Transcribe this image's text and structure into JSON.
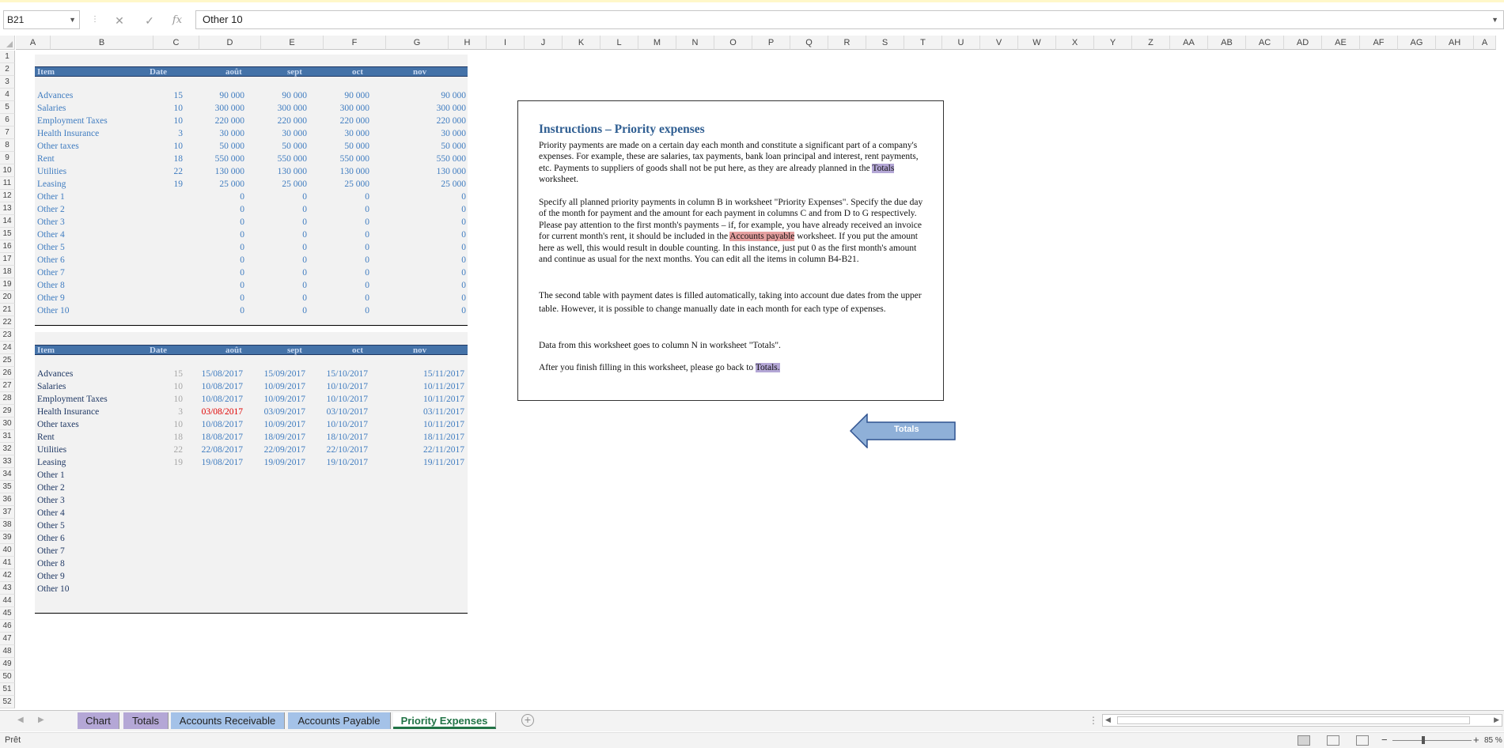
{
  "formula_bar": {
    "name_box": "B21",
    "content": "Other 10"
  },
  "columns": [
    "A",
    "B",
    "C",
    "D",
    "E",
    "F",
    "G",
    "H",
    "I",
    "J",
    "K",
    "L",
    "M",
    "N",
    "O",
    "P",
    "Q",
    "R",
    "S",
    "T",
    "U",
    "V",
    "W",
    "X",
    "Y",
    "Z",
    "AA",
    "AB",
    "AC",
    "AD",
    "AE",
    "AF",
    "AG",
    "AH",
    "A"
  ],
  "rows": [
    "1",
    "2",
    "3",
    "4",
    "5",
    "6",
    "7",
    "8",
    "9",
    "10",
    "11",
    "12",
    "13",
    "14",
    "15",
    "16",
    "17",
    "18",
    "19",
    "20",
    "21",
    "22",
    "23",
    "24",
    "25",
    "26",
    "27",
    "28",
    "29",
    "30",
    "31",
    "32",
    "33",
    "34",
    "35",
    "36",
    "37",
    "38",
    "39",
    "40",
    "41",
    "42",
    "43",
    "44",
    "45",
    "46",
    "47",
    "48",
    "49",
    "50",
    "51",
    "52"
  ],
  "table1": {
    "headers": [
      "Item",
      "Date",
      "août",
      "sept",
      "oct",
      "nov"
    ],
    "rows": [
      {
        "item": "Advances",
        "day": "15",
        "m1": "90 000",
        "m2": "90 000",
        "m3": "90 000",
        "m4": "90 000"
      },
      {
        "item": "Salaries",
        "day": "10",
        "m1": "300 000",
        "m2": "300 000",
        "m3": "300 000",
        "m4": "300 000"
      },
      {
        "item": "Employment Taxes",
        "day": "10",
        "m1": "220 000",
        "m2": "220 000",
        "m3": "220 000",
        "m4": "220 000"
      },
      {
        "item": "Health Insurance",
        "day": "3",
        "m1": "30 000",
        "m2": "30 000",
        "m3": "30 000",
        "m4": "30 000"
      },
      {
        "item": "Other taxes",
        "day": "10",
        "m1": "50 000",
        "m2": "50 000",
        "m3": "50 000",
        "m4": "50 000"
      },
      {
        "item": "Rent",
        "day": "18",
        "m1": "550 000",
        "m2": "550 000",
        "m3": "550 000",
        "m4": "550 000"
      },
      {
        "item": "Utilities",
        "day": "22",
        "m1": "130 000",
        "m2": "130 000",
        "m3": "130 000",
        "m4": "130 000"
      },
      {
        "item": "Leasing",
        "day": "19",
        "m1": "25 000",
        "m2": "25 000",
        "m3": "25 000",
        "m4": "25 000"
      },
      {
        "item": "Other 1",
        "day": "",
        "m1": "0",
        "m2": "0",
        "m3": "0",
        "m4": "0"
      },
      {
        "item": "Other 2",
        "day": "",
        "m1": "0",
        "m2": "0",
        "m3": "0",
        "m4": "0"
      },
      {
        "item": "Other 3",
        "day": "",
        "m1": "0",
        "m2": "0",
        "m3": "0",
        "m4": "0"
      },
      {
        "item": "Other 4",
        "day": "",
        "m1": "0",
        "m2": "0",
        "m3": "0",
        "m4": "0"
      },
      {
        "item": "Other 5",
        "day": "",
        "m1": "0",
        "m2": "0",
        "m3": "0",
        "m4": "0"
      },
      {
        "item": "Other 6",
        "day": "",
        "m1": "0",
        "m2": "0",
        "m3": "0",
        "m4": "0"
      },
      {
        "item": "Other 7",
        "day": "",
        "m1": "0",
        "m2": "0",
        "m3": "0",
        "m4": "0"
      },
      {
        "item": "Other 8",
        "day": "",
        "m1": "0",
        "m2": "0",
        "m3": "0",
        "m4": "0"
      },
      {
        "item": "Other 9",
        "day": "",
        "m1": "0",
        "m2": "0",
        "m3": "0",
        "m4": "0"
      },
      {
        "item": "Other 10",
        "day": "",
        "m1": "0",
        "m2": "0",
        "m3": "0",
        "m4": "0"
      }
    ]
  },
  "table2": {
    "headers": [
      "Item",
      "Date",
      "août",
      "sept",
      "oct",
      "nov"
    ],
    "rows": [
      {
        "item": "Advances",
        "day": "15",
        "m1": "15/08/2017",
        "m2": "15/09/2017",
        "m3": "15/10/2017",
        "m4": "15/11/2017"
      },
      {
        "item": "Salaries",
        "day": "10",
        "m1": "10/08/2017",
        "m2": "10/09/2017",
        "m3": "10/10/2017",
        "m4": "10/11/2017"
      },
      {
        "item": "Employment Taxes",
        "day": "10",
        "m1": "10/08/2017",
        "m2": "10/09/2017",
        "m3": "10/10/2017",
        "m4": "10/11/2017"
      },
      {
        "item": "Health Insurance",
        "day": "3",
        "m1": "03/08/2017",
        "m2": "03/09/2017",
        "m3": "03/10/2017",
        "m4": "03/11/2017",
        "alert": true
      },
      {
        "item": "Other taxes",
        "day": "10",
        "m1": "10/08/2017",
        "m2": "10/09/2017",
        "m3": "10/10/2017",
        "m4": "10/11/2017"
      },
      {
        "item": "Rent",
        "day": "18",
        "m1": "18/08/2017",
        "m2": "18/09/2017",
        "m3": "18/10/2017",
        "m4": "18/11/2017"
      },
      {
        "item": "Utilities",
        "day": "22",
        "m1": "22/08/2017",
        "m2": "22/09/2017",
        "m3": "22/10/2017",
        "m4": "22/11/2017"
      },
      {
        "item": "Leasing",
        "day": "19",
        "m1": "19/08/2017",
        "m2": "19/09/2017",
        "m3": "19/10/2017",
        "m4": "19/11/2017"
      },
      {
        "item": "Other 1",
        "day": "",
        "m1": "",
        "m2": "",
        "m3": "",
        "m4": ""
      },
      {
        "item": "Other 2",
        "day": "",
        "m1": "",
        "m2": "",
        "m3": "",
        "m4": ""
      },
      {
        "item": "Other 3",
        "day": "",
        "m1": "",
        "m2": "",
        "m3": "",
        "m4": ""
      },
      {
        "item": "Other 4",
        "day": "",
        "m1": "",
        "m2": "",
        "m3": "",
        "m4": ""
      },
      {
        "item": "Other 5",
        "day": "",
        "m1": "",
        "m2": "",
        "m3": "",
        "m4": ""
      },
      {
        "item": "Other 6",
        "day": "",
        "m1": "",
        "m2": "",
        "m3": "",
        "m4": ""
      },
      {
        "item": "Other 7",
        "day": "",
        "m1": "",
        "m2": "",
        "m3": "",
        "m4": ""
      },
      {
        "item": "Other 8",
        "day": "",
        "m1": "",
        "m2": "",
        "m3": "",
        "m4": ""
      },
      {
        "item": "Other 9",
        "day": "",
        "m1": "",
        "m2": "",
        "m3": "",
        "m4": ""
      },
      {
        "item": "Other 10",
        "day": "",
        "m1": "",
        "m2": "",
        "m3": "",
        "m4": ""
      }
    ]
  },
  "instructions": {
    "title": "Instructions – Priority expenses",
    "p1_a": "Priority payments are made on a certain day each month and constitute a significant part of a company's expenses. For example, these are salaries, tax payments, bank loan principal and interest, rent payments, etc. Payments to suppliers of goods shall not be put here, as they are already planned in the ",
    "p1_link": "Totals",
    "p1_b": " worksheet.",
    "p2_a": "Specify all planned priority payments in column B in worksheet \"Priority Expenses\". Specify the due day of the month for payment and the amount for each payment in columns C and from D to G respectively. Please pay attention to the first month's payments – if, for example, you have already received an invoice for current month's rent, it should be included in the ",
    "p2_link": "Accounts payable",
    "p2_b": " worksheet. If you put the amount here as well, this would result in double counting. In this instance, just put 0 as the first month's amount and continue as usual for the next months. You can edit all the items in column B4-B21.",
    "p3": "The second table with payment dates is filled automatically, taking into account due dates from the upper table. However, it is possible to change manually date in each month for each type of expenses.",
    "p4": "Data from this worksheet goes to column N in worksheet \"Totals\".",
    "p5_a": "After you finish filling in this worksheet, please go back to ",
    "p5_link": "Totals."
  },
  "arrow_button": {
    "label": "Totals"
  },
  "tabs": [
    "Chart",
    "Totals",
    "Accounts Receivable",
    "Accounts Payable",
    "Priority Expenses"
  ],
  "status": {
    "text": "Prêt",
    "zoom": "85 %"
  },
  "colors": {
    "header_blue": "#4472a8",
    "label_blue": "#3f7cc0",
    "label_dark": "#1f3864",
    "alert_red": "#e00000",
    "tab_purple": "#b4a7d6",
    "tab_blue": "#a4c2e8",
    "active_tab_green": "#217346"
  }
}
